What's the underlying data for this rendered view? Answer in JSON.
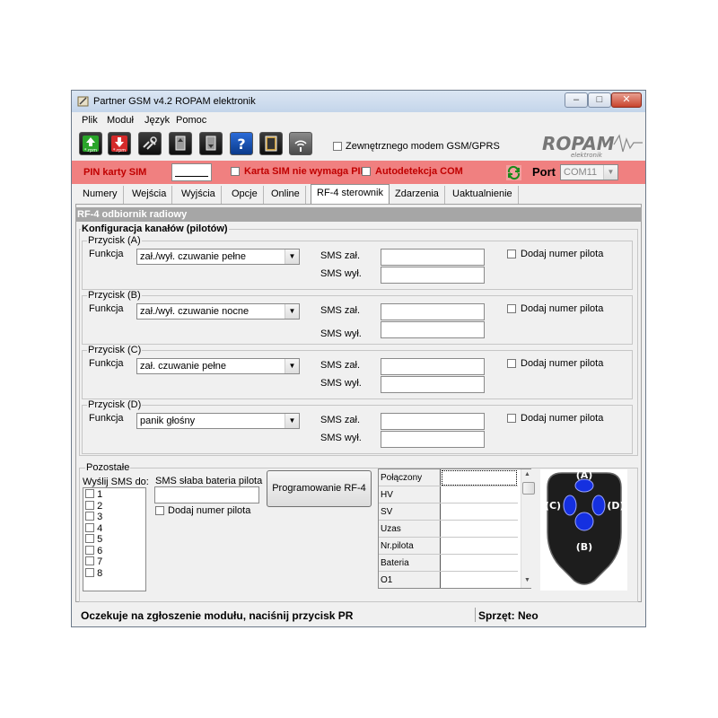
{
  "window": {
    "title": "Partner GSM v4.2 ROPAM elektronik",
    "controls": {
      "minimize": "–",
      "maximize": "□",
      "close": "✕"
    }
  },
  "menu": [
    "Plik",
    "Moduł",
    "Język",
    "Pomoc"
  ],
  "toolbar": {
    "buttons": [
      {
        "icon": "rpm-upload-icon",
        "label": "*.rpm"
      },
      {
        "icon": "rpm-download-icon",
        "label": "*.rpm"
      },
      {
        "icon": "connect-icon",
        "label": ""
      },
      {
        "icon": "read-module-icon",
        "label": ""
      },
      {
        "icon": "write-module-icon",
        "label": ""
      },
      {
        "icon": "help-icon",
        "label": "?"
      },
      {
        "icon": "exit-icon",
        "label": ""
      },
      {
        "icon": "signal-icon",
        "label": ""
      }
    ],
    "external_modem_label": "Zewnętrznego modem GSM/GPRS",
    "logo_text": "ROPAM",
    "logo_sub": "elektronik"
  },
  "pinbar": {
    "pin_label": "PIN karty SIM",
    "pin_value": "",
    "sim_no_pin_label": "Karta SIM nie wymaga PIN",
    "autodetect_label": "Autodetekcja COM",
    "port_label": "Port",
    "port_value": "COM11"
  },
  "tabs": [
    "Numery",
    "Wejścia",
    "Wyjścia",
    "Opcje",
    "Online",
    "RF-4 sterownik",
    "Zdarzenia",
    "Uaktualnienie"
  ],
  "active_tab": "RF-4 sterownik",
  "rf4": {
    "header": "RF-4 odbiornik radiowy",
    "config_title": "Konfiguracja kanałów (pilotów)",
    "function_label": "Funkcja",
    "sms_on_label": "SMS zał.",
    "sms_off_label": "SMS wył.",
    "add_pilot_label": "Dodaj numer pilota",
    "buttons": [
      {
        "title": "Przycisk (A)",
        "function": "zał./wył. czuwanie pełne"
      },
      {
        "title": "Przycisk (B)",
        "function": "zał./wył. czuwanie nocne"
      },
      {
        "title": "Przycisk (C)",
        "function": "zał. czuwanie pełne"
      },
      {
        "title": "Przycisk (D)",
        "function": "panik głośny"
      }
    ]
  },
  "other": {
    "title": "Pozostałe",
    "send_sms_label": "Wyślij SMS do:",
    "numbers": [
      "1",
      "2",
      "3",
      "4",
      "5",
      "6",
      "7",
      "8"
    ],
    "low_battery_label": "SMS słaba bateria pilota",
    "add_pilot_label": "Dodaj numer pilota",
    "program_button": "Programowanie  RF-4",
    "status_rows": [
      "Połączony",
      "HV",
      "SV",
      "Uzas",
      "Nr.pilota",
      "Bateria",
      "O1"
    ],
    "remote_labels": [
      "(A)",
      "(B)",
      "(C)",
      "(D)"
    ]
  },
  "status": {
    "message": "Oczekuje na zgłoszenie modułu, naciśnij przycisk PR",
    "hardware": "Sprzęt: Neo"
  }
}
